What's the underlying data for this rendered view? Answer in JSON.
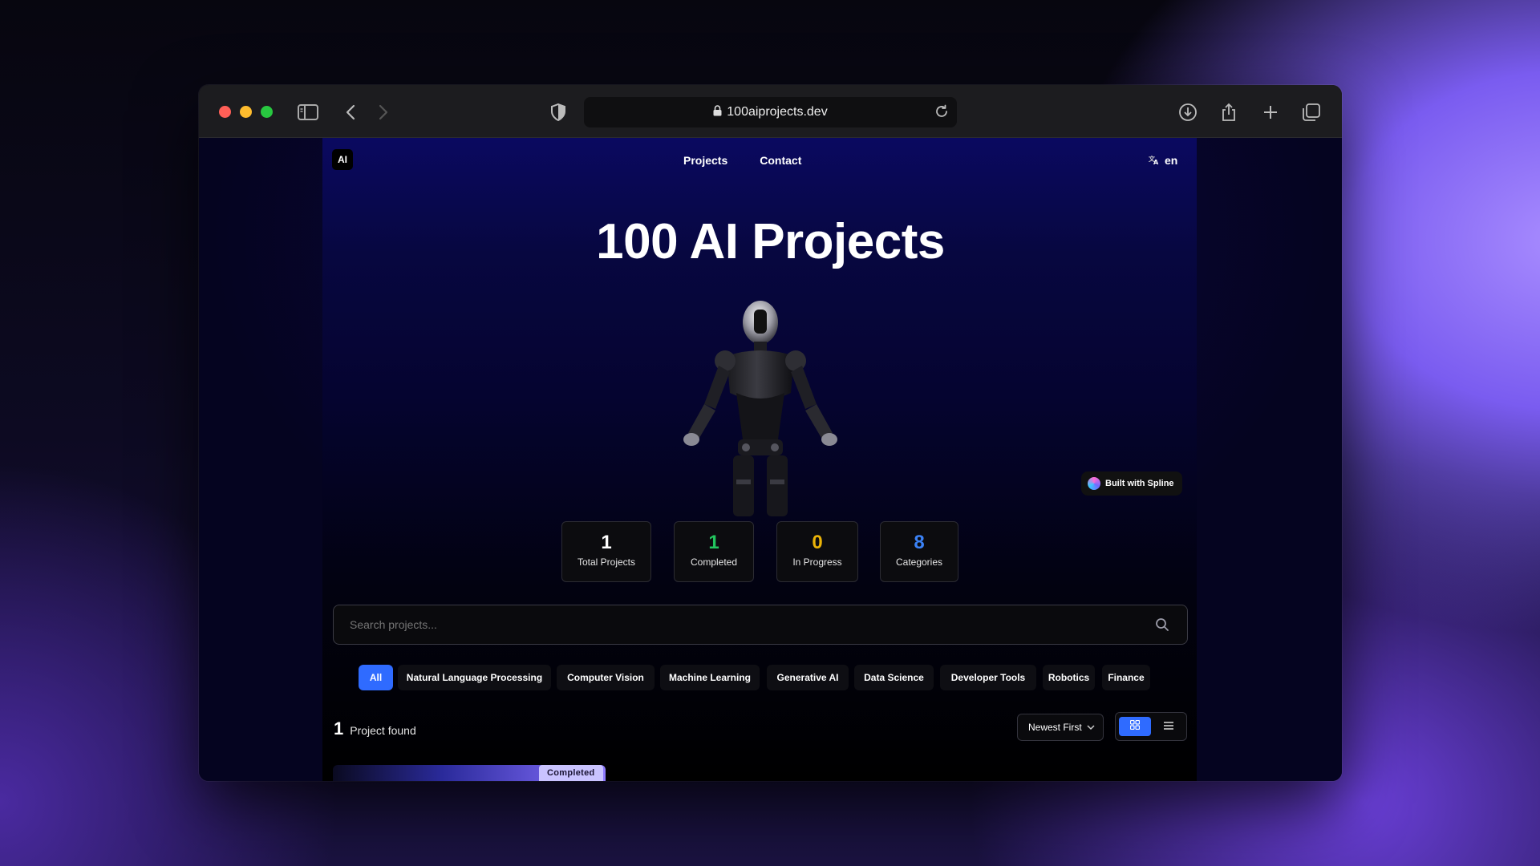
{
  "browser": {
    "url": "100aiprojects.dev"
  },
  "nav": {
    "logo": "AI",
    "links": [
      "Projects",
      "Contact"
    ],
    "language": "en"
  },
  "hero": {
    "title": "100 AI Projects",
    "spline_badge": "Built with Spline"
  },
  "stats": [
    {
      "value": "1",
      "label": "Total Projects",
      "color": "#ffffff"
    },
    {
      "value": "1",
      "label": "Completed",
      "color": "#22c55e"
    },
    {
      "value": "0",
      "label": "In Progress",
      "color": "#eab308"
    },
    {
      "value": "8",
      "label": "Categories",
      "color": "#3b82f6"
    }
  ],
  "search": {
    "placeholder": "Search projects..."
  },
  "categories": [
    {
      "label": "All",
      "active": true
    },
    {
      "label": "Natural Language Processing",
      "active": false
    },
    {
      "label": "Computer Vision",
      "active": false
    },
    {
      "label": "Machine Learning",
      "active": false
    },
    {
      "label": "Generative AI",
      "active": false
    },
    {
      "label": "Data Science",
      "active": false
    },
    {
      "label": "Developer Tools",
      "active": false
    },
    {
      "label": "Robotics",
      "active": false
    },
    {
      "label": "Finance",
      "active": false
    }
  ],
  "results": {
    "count": "1",
    "label": "Project found",
    "sort": "Newest First",
    "view": "grid"
  },
  "card": {
    "status": "Completed"
  },
  "colors": {
    "accent": "#2f6bff",
    "completed": "#22c55e",
    "in_progress": "#eab308",
    "categories": "#3b82f6"
  }
}
